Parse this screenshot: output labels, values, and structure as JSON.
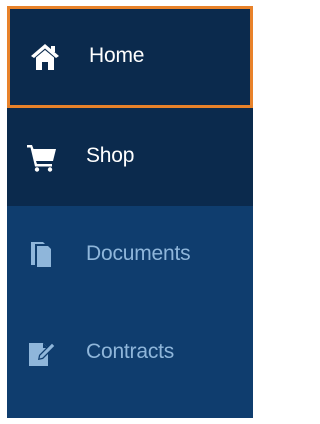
{
  "nav": {
    "items": [
      {
        "label": "Home",
        "icon": "home-icon",
        "state": "selected"
      },
      {
        "label": "Shop",
        "icon": "shopping-cart-icon",
        "state": "enabled"
      },
      {
        "label": "Documents",
        "icon": "documents-icon",
        "state": "disabled"
      },
      {
        "label": "Contracts",
        "icon": "contract-edit-icon",
        "state": "disabled"
      }
    ]
  },
  "colors": {
    "active_bg": "#0b2a4d",
    "inactive_bg": "#0f3d6e",
    "focus_border": "#e8822a",
    "active_text": "#ffffff",
    "muted_text": "#8fb6da"
  }
}
